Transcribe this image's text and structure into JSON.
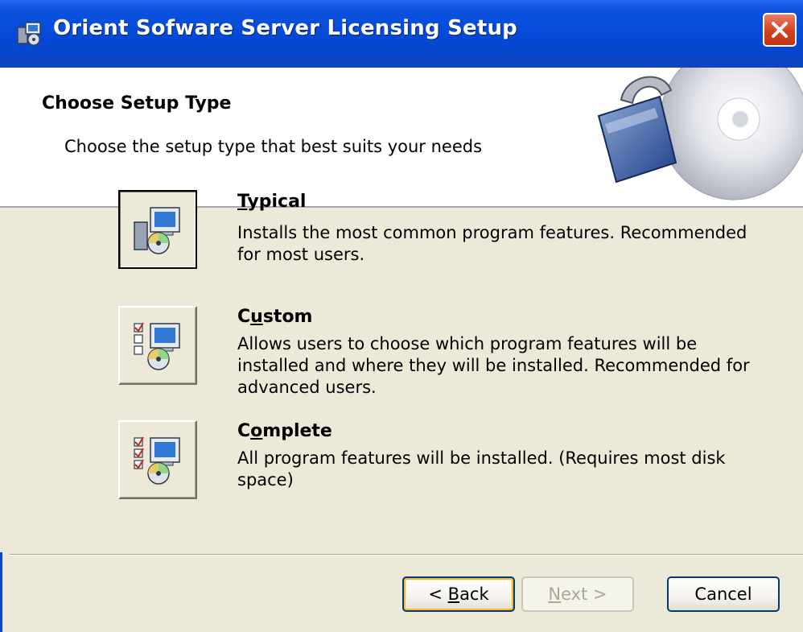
{
  "window": {
    "title": "Orient Sofware Server Licensing Setup",
    "icons": {
      "app": "installer-icon",
      "close": "close-icon"
    }
  },
  "banner": {
    "title": "Choose Setup Type",
    "subtitle": "Choose the setup type that best suits your needs",
    "art": "padlock-cd-icon"
  },
  "options": [
    {
      "label_pre": "",
      "label_accel": "T",
      "label_post": "ypical",
      "icon": "typical-setup-icon",
      "description": "Installs the most common program features. Recommended for most users."
    },
    {
      "label_pre": "C",
      "label_accel": "u",
      "label_post": "stom",
      "icon": "custom-setup-icon",
      "description": "Allows users to choose which program features will be installed and where they will be installed. Recommended for advanced users."
    },
    {
      "label_pre": "C",
      "label_accel": "o",
      "label_post": "mplete",
      "icon": "complete-setup-icon",
      "description": "All program features will be installed. (Requires most disk space)"
    }
  ],
  "buttons": {
    "back_pre": "< ",
    "back_accel": "B",
    "back_post": "ack",
    "next_accel": "N",
    "next_post": "ext >",
    "cancel": "Cancel"
  },
  "colors": {
    "titlebar": "#0449d6",
    "face": "#ece9d8",
    "close": "#d3411b"
  }
}
